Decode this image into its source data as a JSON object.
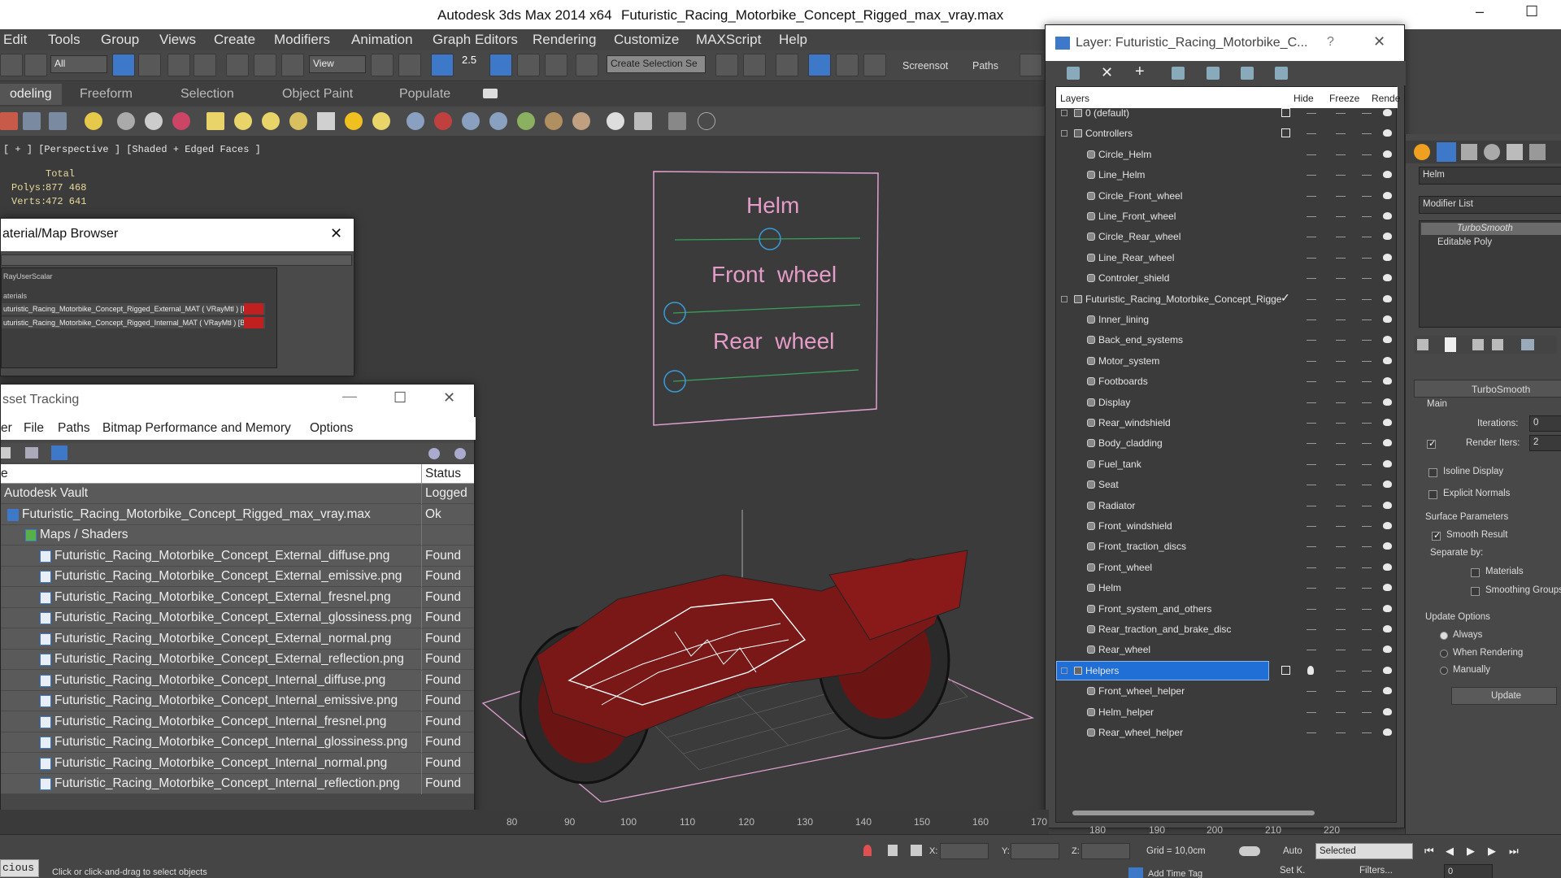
{
  "titlebar": {
    "app": "Autodesk 3ds Max  2014 x64",
    "file": "Futuristic_Racing_Motorbike_Concept_Rigged_max_vray.max",
    "min": "–",
    "max": "☐"
  },
  "menu": [
    "Edit",
    "Tools",
    "Group",
    "Views",
    "Create",
    "Modifiers",
    "Animation",
    "Graph Editors",
    "Rendering",
    "Customize",
    "MAXScript",
    "Help"
  ],
  "toolbar": {
    "filter": "All",
    "refcoord": "View",
    "selection_set": "Create Selection Se",
    "screenshot": "Screensot",
    "paths": "Paths",
    "snap_angle": "2.5"
  },
  "ribbon_tabs": [
    "odeling",
    "Freeform",
    "Selection",
    "Object Paint",
    "Populate"
  ],
  "viewport": {
    "label": "[ + ] [Perspective ] [Shaded + Edged Faces ]",
    "total": "Total",
    "polys_label": "Polys:",
    "polys": "877 468",
    "verts_label": "Verts:",
    "verts": "472 641"
  },
  "controls_panel": {
    "helm": "Helm",
    "front": "Front  wheel",
    "rear": "Rear  wheel"
  },
  "material_browser": {
    "title": "aterial/Map Browser",
    "close": "✕",
    "item_scalar": "RayUserScalar",
    "group": "aterials",
    "mat1": "uturistic_Racing_Motorbike_Concept_Rigged_External_MAT ( VRayMtl ) [B",
    "mat2": "uturistic_Racing_Motorbike_Concept_Rigged_Internal_MAT ( VRayMtl ) [Ba"
  },
  "asset_tracking": {
    "title": "sset Tracking",
    "min": "—",
    "max": "☐",
    "close": "✕",
    "menu": [
      "er",
      "File",
      "Paths",
      "Bitmap Performance and Memory",
      "Options"
    ],
    "col_name": "e",
    "col_status": "Status",
    "rows": [
      {
        "name": "Autodesk Vault",
        "status": "Logged",
        "indent": 0
      },
      {
        "name": "Futuristic_Racing_Motorbike_Concept_Rigged_max_vray.max",
        "status": "Ok",
        "indent": 1
      },
      {
        "name": "Maps / Shaders",
        "status": "",
        "indent": 2
      },
      {
        "name": "Futuristic_Racing_Motorbike_Concept_External_diffuse.png",
        "status": "Found",
        "indent": 3
      },
      {
        "name": "Futuristic_Racing_Motorbike_Concept_External_emissive.png",
        "status": "Found",
        "indent": 3
      },
      {
        "name": "Futuristic_Racing_Motorbike_Concept_External_fresnel.png",
        "status": "Found",
        "indent": 3
      },
      {
        "name": "Futuristic_Racing_Motorbike_Concept_External_glossiness.png",
        "status": "Found",
        "indent": 3
      },
      {
        "name": "Futuristic_Racing_Motorbike_Concept_External_normal.png",
        "status": "Found",
        "indent": 3
      },
      {
        "name": "Futuristic_Racing_Motorbike_Concept_External_reflection.png",
        "status": "Found",
        "indent": 3
      },
      {
        "name": "Futuristic_Racing_Motorbike_Concept_Internal_diffuse.png",
        "status": "Found",
        "indent": 3
      },
      {
        "name": "Futuristic_Racing_Motorbike_Concept_Internal_emissive.png",
        "status": "Found",
        "indent": 3
      },
      {
        "name": "Futuristic_Racing_Motorbike_Concept_Internal_fresnel.png",
        "status": "Found",
        "indent": 3
      },
      {
        "name": "Futuristic_Racing_Motorbike_Concept_Internal_glossiness.png",
        "status": "Found",
        "indent": 3
      },
      {
        "name": "Futuristic_Racing_Motorbike_Concept_Internal_normal.png",
        "status": "Found",
        "indent": 3
      },
      {
        "name": "Futuristic_Racing_Motorbike_Concept_Internal_reflection.png",
        "status": "Found",
        "indent": 3
      }
    ]
  },
  "layer_window": {
    "title": "Layer: Futuristic_Racing_Motorbike_C...",
    "help": "?",
    "close": "✕",
    "col_layers": "Layers",
    "col_hide": "Hide",
    "col_freeze": "Freeze",
    "col_render": "Rende",
    "rows": [
      {
        "name": "0 (default)",
        "level": 0,
        "type": "layer",
        "box": true
      },
      {
        "name": "Controllers",
        "level": 0,
        "type": "layer",
        "box": true
      },
      {
        "name": "Circle_Helm",
        "level": 1,
        "type": "obj"
      },
      {
        "name": "Line_Helm",
        "level": 1,
        "type": "obj"
      },
      {
        "name": "Circle_Front_wheel",
        "level": 1,
        "type": "obj"
      },
      {
        "name": "Line_Front_wheel",
        "level": 1,
        "type": "obj"
      },
      {
        "name": "Circle_Rear_wheel",
        "level": 1,
        "type": "obj"
      },
      {
        "name": "Line_Rear_wheel",
        "level": 1,
        "type": "obj"
      },
      {
        "name": "Controler_shield",
        "level": 1,
        "type": "obj"
      },
      {
        "name": "Futuristic_Racing_Motorbike_Concept_Rigge",
        "level": 0,
        "type": "layer",
        "check": true
      },
      {
        "name": "Inner_lining",
        "level": 1,
        "type": "obj"
      },
      {
        "name": "Back_end_systems",
        "level": 1,
        "type": "obj"
      },
      {
        "name": "Motor_system",
        "level": 1,
        "type": "obj"
      },
      {
        "name": "Footboards",
        "level": 1,
        "type": "obj"
      },
      {
        "name": "Display",
        "level": 1,
        "type": "obj"
      },
      {
        "name": "Rear_windshield",
        "level": 1,
        "type": "obj"
      },
      {
        "name": "Body_cladding",
        "level": 1,
        "type": "obj"
      },
      {
        "name": "Fuel_tank",
        "level": 1,
        "type": "obj"
      },
      {
        "name": "Seat",
        "level": 1,
        "type": "obj"
      },
      {
        "name": "Radiator",
        "level": 1,
        "type": "obj"
      },
      {
        "name": "Front_windshield",
        "level": 1,
        "type": "obj"
      },
      {
        "name": "Front_traction_discs",
        "level": 1,
        "type": "obj"
      },
      {
        "name": "Front_wheel",
        "level": 1,
        "type": "obj"
      },
      {
        "name": "Helm",
        "level": 1,
        "type": "obj"
      },
      {
        "name": "Front_system_and_others",
        "level": 1,
        "type": "obj"
      },
      {
        "name": "Rear_traction_and_brake_disc",
        "level": 1,
        "type": "obj"
      },
      {
        "name": "Rear_wheel",
        "level": 1,
        "type": "obj"
      },
      {
        "name": "Helpers",
        "level": 0,
        "type": "layer",
        "selected": true,
        "box": true,
        "bulb": true
      },
      {
        "name": "Front_wheel_helper",
        "level": 1,
        "type": "obj"
      },
      {
        "name": "Helm_helper",
        "level": 1,
        "type": "obj"
      },
      {
        "name": "Rear_wheel_helper",
        "level": 1,
        "type": "obj"
      }
    ]
  },
  "command_panel": {
    "object_name": "Helm",
    "modifier_list": "Modifier List",
    "stack": [
      "TurboSmooth",
      "Editable Poly"
    ],
    "rollout": "TurboSmooth",
    "main": "Main",
    "iterations_label": "Iterations:",
    "iterations": "0",
    "render_iters_label": "Render Iters:",
    "render_iters": "2",
    "isoline": "Isoline Display",
    "explicit_normals": "Explicit Normals",
    "surface_params": "Surface Parameters",
    "smooth_result": "Smooth Result",
    "separate_by": "Separate by:",
    "materials": "Materials",
    "smoothing_groups": "Smoothing Groups",
    "update_options": "Update Options",
    "always": "Always",
    "when_rendering": "When Rendering",
    "manually": "Manually",
    "update_btn": "Update"
  },
  "timeline": {
    "ticks": [
      "80",
      "90",
      "100",
      "110",
      "120",
      "130",
      "140",
      "150",
      "160",
      "170",
      "180",
      "190",
      "200",
      "210",
      "220"
    ]
  },
  "statusbar": {
    "maxscript": "cious",
    "prompt": "Click or click-and-drag to select objects",
    "x_label": "X:",
    "y_label": "Y:",
    "z_label": "Z:",
    "grid": "Grid = 10,0cm",
    "auto": "Auto",
    "selected": "Selected",
    "setk": "Set K.",
    "filters": "Filters...",
    "add_time_tag": "Add Time Tag",
    "frame": "0"
  },
  "colors": {
    "accent": "#3e78c8",
    "selected_row": "#1f6fd6",
    "motorbike_red": "#8a1a1a",
    "wire": "#e8a8c8"
  }
}
